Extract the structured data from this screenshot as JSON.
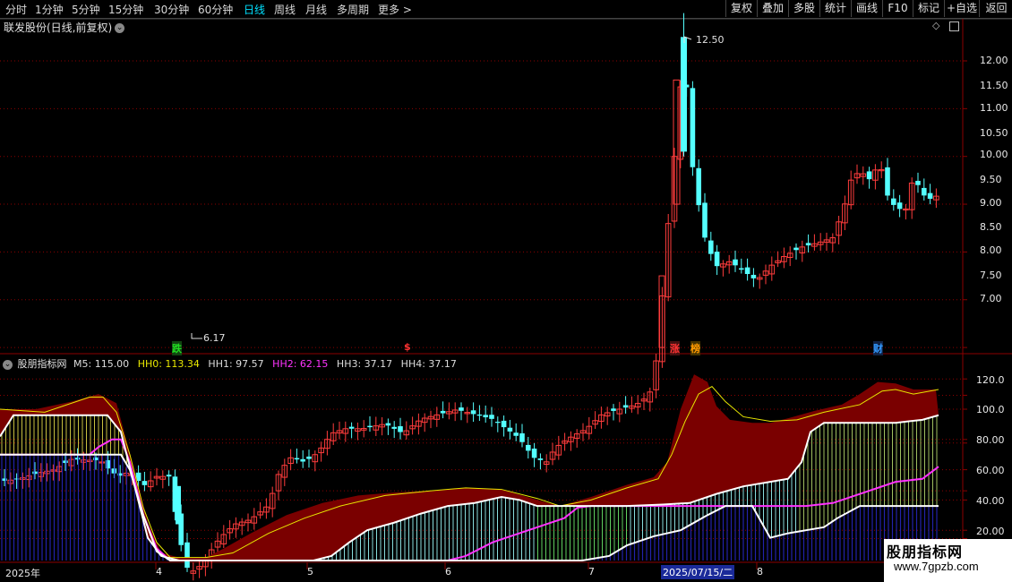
{
  "toolbar": {
    "periods": [
      "分时",
      "1分钟",
      "5分钟",
      "15分钟",
      "30分钟",
      "60分钟",
      "日线",
      "周线",
      "月线",
      "多周期",
      "更多"
    ],
    "more_arrow": ">",
    "buttons": [
      "复权",
      "叠加",
      "多股",
      "统计",
      "画线",
      "F10",
      "标记",
      "+自选",
      "返回"
    ]
  },
  "main_chart": {
    "title": "联发股份(日线,前复权)",
    "high_label": "12.50",
    "low_label": "6.17",
    "y_ticks": [
      "12.00",
      "11.50",
      "11.00",
      "10.50",
      "10.00",
      "9.50",
      "9.00",
      "8.50",
      "8.00",
      "7.50",
      "7.00"
    ],
    "signals": [
      {
        "text": "跌",
        "color": "#22dd22"
      },
      {
        "text": "$",
        "color": "#ff3333"
      },
      {
        "text": "涨",
        "color": "#ff3333"
      },
      {
        "text": "榜",
        "color": "#ff9900"
      },
      {
        "text": "财",
        "color": "#3399ff"
      }
    ]
  },
  "indicator": {
    "name": "股朋指标网",
    "values": [
      {
        "label": "M5: 115.00",
        "color": "#e0e0e0"
      },
      {
        "label": "HH0: 113.34",
        "color": "#e8e800"
      },
      {
        "label": "HH1: 97.57",
        "color": "#e0e0e0"
      },
      {
        "label": "HH2: 62.15",
        "color": "#ff33ff"
      },
      {
        "label": "HH3: 37.17",
        "color": "#e0e0e0"
      },
      {
        "label": "HH4: 37.17",
        "color": "#e0e0e0"
      }
    ],
    "y_ticks": [
      "120.0",
      "100.0",
      "80.00",
      "60.00",
      "40.00",
      "20.00"
    ]
  },
  "x_axis": {
    "labels": [
      "2025年",
      "4",
      "5",
      "6",
      "7",
      "8"
    ],
    "cursor_date": "2025/07/15/二"
  },
  "watermark": {
    "line1": "股朋指标网",
    "line2": "www.7gpzb.com"
  },
  "colors": {
    "up": "#ff3c3c",
    "down": "#54ffff",
    "grid": "#8b0000",
    "dark_red": "#7a0000",
    "white": "#ffffff",
    "yellow": "#e8e800",
    "magenta": "#ff33ff"
  }
}
